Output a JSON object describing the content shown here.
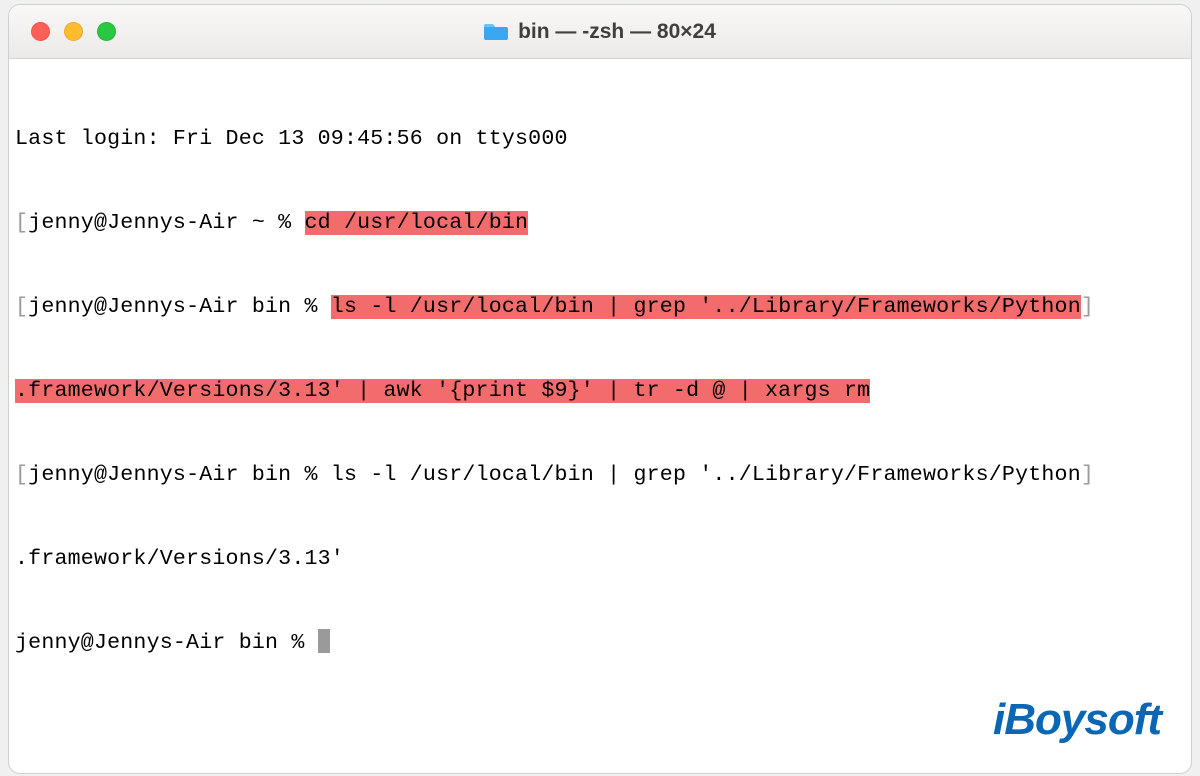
{
  "window": {
    "title": "bin — -zsh — 80×24"
  },
  "terminal": {
    "last_login": "Last login: Fri Dec 13 09:45:56 on ttys000",
    "line1_prompt": "jenny@Jennys-Air ~ % ",
    "line1_cmd": "cd /usr/local/bin",
    "line2_prompt": "jenny@Jennys-Air bin % ",
    "line2_cmd_a": "ls -l /usr/local/bin | grep '../Library/Frameworks/Python",
    "line2_cmd_b": ".framework/Versions/3.13' | awk '{print $9}' | tr -d @ | xargs rm",
    "line3_prompt": "jenny@Jennys-Air bin % ",
    "line3_cmd_a": "ls -l /usr/local/bin | grep '../Library/Frameworks/Python",
    "line3_cmd_b": ".framework/Versions/3.13'",
    "line4_prompt": "jenny@Jennys-Air bin % "
  },
  "watermark": "iBoysoft"
}
